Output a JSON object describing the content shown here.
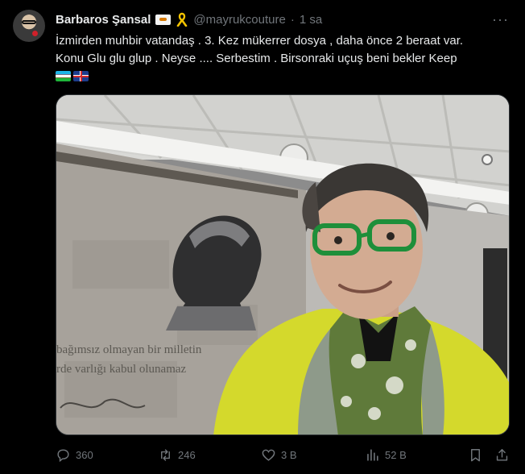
{
  "tweet": {
    "author_name": "Barbaros Şansal",
    "handle": "@mayrukcouture",
    "separator": "·",
    "time": "1 sa",
    "more_label": "···",
    "text_lines": [
      "İzmirden muhbir vatandaş .  3. Kez mükerrer dosya , daha önce 2 beraat var.",
      "Konu Glu glu glup . Neyse ....  Serbestim . Birsonraki uçuş beni bekler Keep"
    ]
  },
  "photo": {
    "wall_text_line1": "bağımsız olmayan bir milletin",
    "wall_text_line2": "rde varlığı kabul olunamaz"
  },
  "actions": {
    "replies": "360",
    "reposts": "246",
    "likes": "3 B",
    "views": "52 B"
  },
  "colors": {
    "background": "#000000",
    "text": "#e7e9ea",
    "muted": "#71767b",
    "border": "#2f3336"
  }
}
